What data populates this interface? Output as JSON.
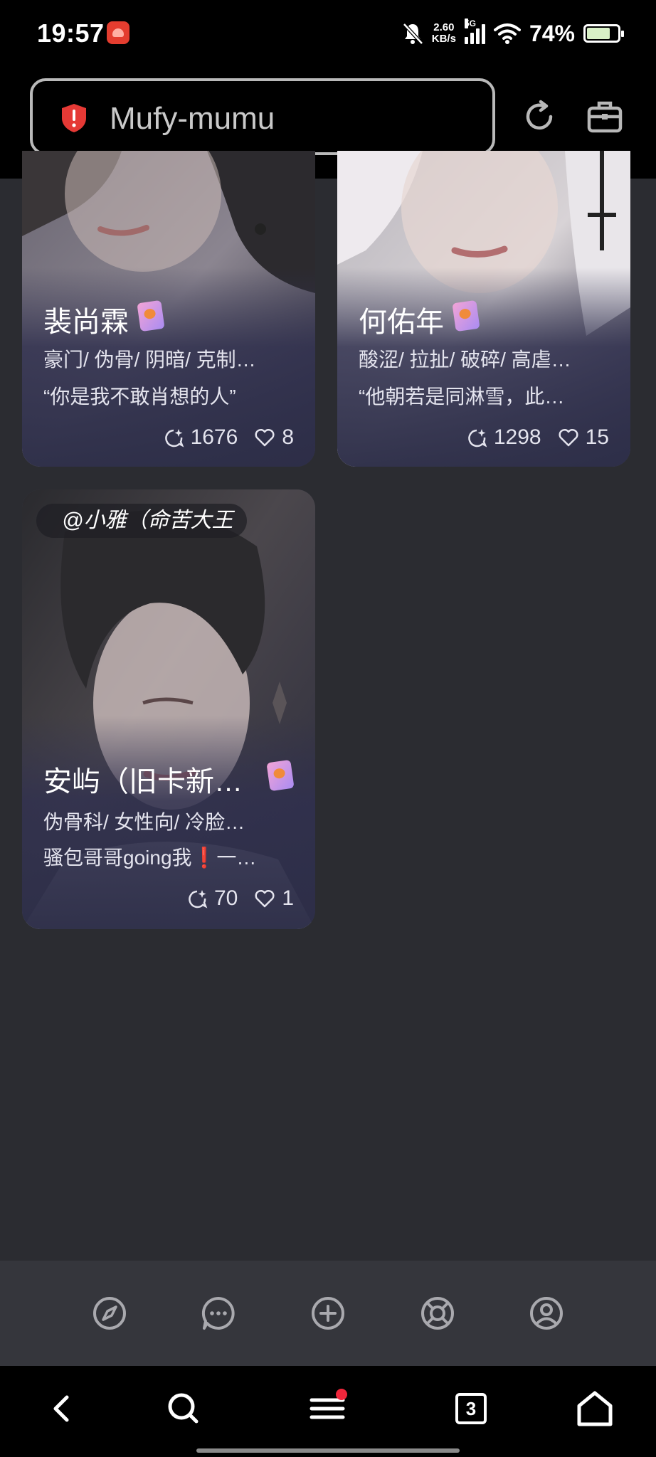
{
  "status_bar": {
    "time": "19:57",
    "net_speed_value": "2.60",
    "net_speed_unit": "KB/s",
    "network": "5G",
    "battery": "74%"
  },
  "header": {
    "url": "Mufy-mumu",
    "accent_color": "#e53935"
  },
  "cards": [
    {
      "name": "裴尚霖",
      "tags": "豪门/ 伪骨/ 阴暗/ 克制…",
      "quote": "“你是我不敢肖想的人”",
      "chats": "1676",
      "likes": "8"
    },
    {
      "name": "何佑年",
      "tags": "酸涩/ 拉扯/ 破碎/ 高虐…",
      "quote": "“他朝若是同淋雪，此…",
      "chats": "1298",
      "likes": "15"
    },
    {
      "author": "@小雅（命苦大王",
      "name": "安屿（旧卡新…",
      "tags": "伪骨科/ 女性向/ 冷脸…",
      "quote": "骚包哥哥going我❗一…",
      "chats": "70",
      "likes": "1"
    }
  ],
  "app_nav": [
    "compass-icon",
    "chat-icon",
    "create-icon",
    "lifebuoy-icon",
    "profile-icon"
  ],
  "sys_nav": {
    "tab_count": "3"
  }
}
